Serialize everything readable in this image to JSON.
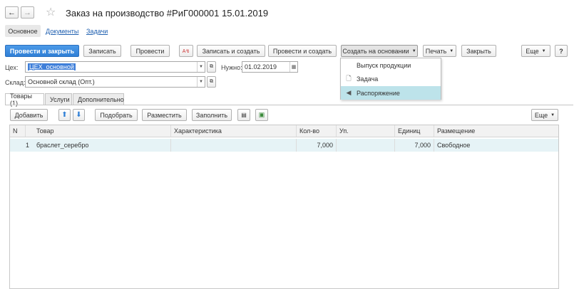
{
  "nav": {
    "back_glyph": "←",
    "forward_glyph": "→",
    "star_glyph": "☆"
  },
  "window": {
    "title": "Заказ на производство #РиГ000001 15.01.2019"
  },
  "sections": {
    "main": "Основное",
    "documents": "Документы",
    "tasks": "Задачи"
  },
  "toolbar": {
    "post_close": "Провести и закрыть",
    "save": "Записать",
    "post": "Провести",
    "save_create": "Записать и создать",
    "post_create": "Провести и создать",
    "create_based": "Создать на основании",
    "print": "Печать",
    "close": "Закрыть",
    "more": "Еще",
    "help": "?"
  },
  "fields": {
    "workshop_label": "Цех:",
    "workshop_value": "ЦЕХ_основной",
    "needed_label": "Нужно:",
    "needed_value": "01.02.2019",
    "warehouse_label": "Склад:",
    "warehouse_value": "Основной склад (Опт.)"
  },
  "tabs": [
    "Товары (1)",
    "Услуги",
    "Дополнительно"
  ],
  "table_toolbar": {
    "add": "Добавить",
    "pick": "Подобрать",
    "place": "Разместить",
    "fill": "Заполнить",
    "more": "Еще"
  },
  "table": {
    "columns": [
      "N",
      "Товар",
      "Характеристика",
      "Кол-во",
      "Уп.",
      "Единиц",
      "Размещение"
    ],
    "rows": [
      {
        "n": "1",
        "item": "браслет_серебро",
        "char": "",
        "qty": "7,000",
        "pack": "",
        "units": "7,000",
        "place": "Свободное"
      }
    ]
  },
  "dropdown_menu": {
    "items": [
      {
        "label": "Выпуск продукции",
        "icon": ""
      },
      {
        "label": "Задача",
        "icon": "document-icon"
      },
      {
        "label": "Распоряжение",
        "icon": "megaphone-icon"
      }
    ],
    "highlighted_index": 2
  }
}
